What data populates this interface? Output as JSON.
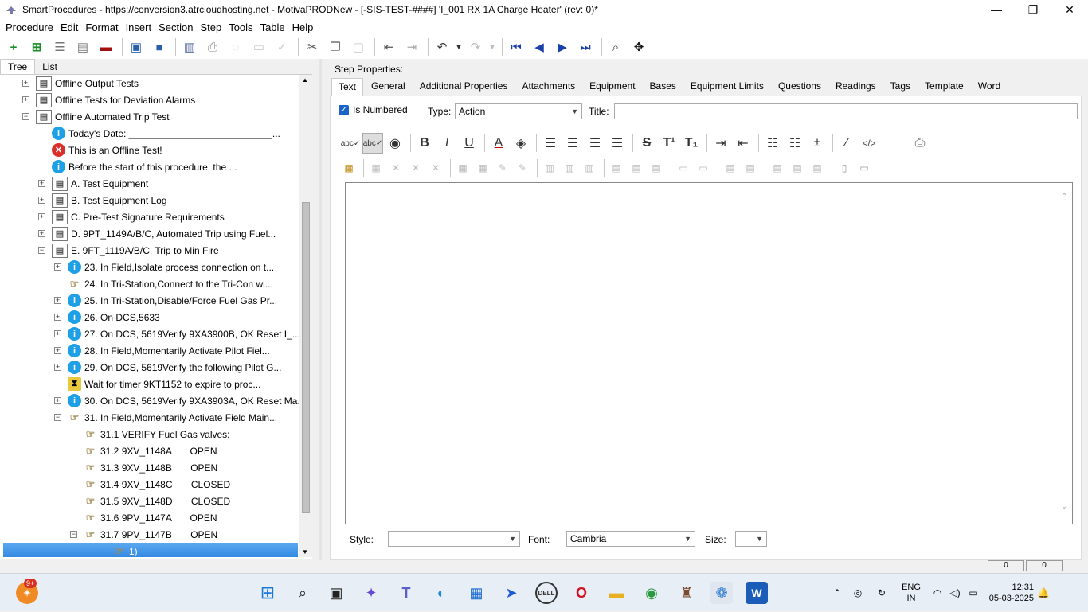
{
  "window": {
    "title": "SmartProcedures - https://conversion3.atrcloudhosting.net - MotivaPRODNew - [-SIS-TEST-####] 'I_001 RX 1A Charge Heater' (rev: 0)*",
    "minimize": "—",
    "maximize": "❐",
    "close": "✕"
  },
  "menu": [
    "Procedure",
    "Edit",
    "Format",
    "Insert",
    "Section",
    "Step",
    "Tools",
    "Table",
    "Help"
  ],
  "left_tabs": [
    "Tree",
    "List"
  ],
  "tree": [
    {
      "label": "Offline Output Tests",
      "icon": "doc",
      "expander": "+",
      "level": 0
    },
    {
      "label": "Offline Tests for Deviation Alarms",
      "icon": "doc",
      "expander": "+",
      "level": 0
    },
    {
      "label": "Offline Automated Trip Test",
      "icon": "doc",
      "expander": "−",
      "level": 0
    },
    {
      "label": "Today's Date: ___________________________...",
      "icon": "info",
      "expander": "",
      "level": 1
    },
    {
      "label": "This is an Offline Test!",
      "icon": "err",
      "expander": "",
      "level": 1
    },
    {
      "label": "Before the start of this procedure, the ...",
      "icon": "info",
      "expander": "",
      "level": 1
    },
    {
      "label": "A. Test Equipment",
      "icon": "doc",
      "expander": "+",
      "level": 1
    },
    {
      "label": "B. Test Equipment Log",
      "icon": "doc",
      "expander": "+",
      "level": 1
    },
    {
      "label": "C. Pre-Test Signature Requirements",
      "icon": "doc",
      "expander": "+",
      "level": 1
    },
    {
      "label": "D. 9PT_1149A/B/C, Automated Trip using Fuel...",
      "icon": "doc",
      "expander": "+",
      "level": 1
    },
    {
      "label": "E. 9FT_1119A/B/C, Trip to Min Fire",
      "icon": "doc",
      "expander": "−",
      "level": 1
    },
    {
      "label": "23. In Field,Isolate process connection on t...",
      "icon": "info",
      "expander": "+",
      "level": 2
    },
    {
      "label": "24. In Tri-Station,Connect to the Tri-Con wi...",
      "icon": "hand",
      "expander": "",
      "level": 2
    },
    {
      "label": "25. In Tri-Station,Disable/Force Fuel Gas Pr...",
      "icon": "info",
      "expander": "+",
      "level": 2
    },
    {
      "label": "26. On DCS,5633",
      "icon": "info",
      "expander": "+",
      "level": 2
    },
    {
      "label": "27. On DCS, 5619Verify 9XA3900B, OK Reset I_...",
      "icon": "info",
      "expander": "+",
      "level": 2
    },
    {
      "label": "28. In Field,Momentarily Activate Pilot Fiel...",
      "icon": "info",
      "expander": "+",
      "level": 2
    },
    {
      "label": "29. On DCS, 5619Verify the following Pilot G...",
      "icon": "info",
      "expander": "+",
      "level": 2
    },
    {
      "label": "Wait for timer 9KT1152 to expire to proc...",
      "icon": "timer",
      "expander": "",
      "level": 2
    },
    {
      "label": "30. On DCS, 5619Verify 9XA3903A, OK Reset Ma...",
      "icon": "info",
      "expander": "+",
      "level": 2
    },
    {
      "label": "31. In Field,Momentarily Activate Field Main...",
      "icon": "hand",
      "expander": "−",
      "level": 2
    },
    {
      "label": "31.1 VERIFY Fuel Gas valves:",
      "icon": "hand",
      "expander": "",
      "level": 3
    },
    {
      "label": "31.2 9XV_1148A       OPEN",
      "icon": "hand",
      "expander": "",
      "level": 3
    },
    {
      "label": "31.3 9XV_1148B       OPEN",
      "icon": "hand",
      "expander": "",
      "level": 3
    },
    {
      "label": "31.4 9XV_1148C       CLOSED",
      "icon": "hand",
      "expander": "",
      "level": 3
    },
    {
      "label": "31.5 9XV_1148D       CLOSED",
      "icon": "hand",
      "expander": "",
      "level": 3
    },
    {
      "label": "31.6 9PV_1147A       OPEN",
      "icon": "hand",
      "expander": "",
      "level": 3
    },
    {
      "label": "31.7 9PV_1147B       OPEN",
      "icon": "hand",
      "expander": "−",
      "level": 3
    },
    {
      "label": "1)",
      "icon": "hand",
      "expander": "",
      "level": 4,
      "selected": true
    }
  ],
  "step_properties": {
    "title": "Step Properties:",
    "tabs": [
      "Text",
      "General",
      "Additional Properties",
      "Attachments",
      "Equipment",
      "Bases",
      "Equipment Limits",
      "Questions",
      "Readings",
      "Tags",
      "Template",
      "Word"
    ],
    "is_numbered_label": "Is Numbered",
    "is_numbered": true,
    "type_label": "Type:",
    "type_value": "Action",
    "title_label": "Title:",
    "title_value": "",
    "style_label": "Style:",
    "style_value": "",
    "font_label": "Font:",
    "font_value": "Cambria",
    "size_label": "Size:",
    "size_value": ""
  },
  "statusbar": {
    "left_box": "0",
    "right_box": "0"
  },
  "taskbar": {
    "notification_badge": "9+",
    "language": "ENG",
    "region": "IN",
    "time": "12:31",
    "date": "05-03-2025"
  },
  "colors": {
    "selection": "#3a8fe4",
    "accent": "#1a64c8"
  }
}
